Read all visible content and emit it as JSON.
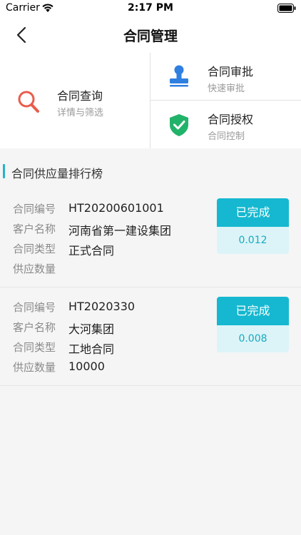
{
  "status_bar": {
    "carrier": "Carrier",
    "time": "2:17 PM"
  },
  "nav": {
    "title": "合同管理"
  },
  "functions": [
    {
      "title": "合同查询",
      "subtitle": "详情与筛选",
      "icon": "search-icon",
      "color": "#e85d4a"
    },
    {
      "title": "合同审批",
      "subtitle": "快速审批",
      "icon": "stamp-icon",
      "color": "#2f7fe0"
    },
    {
      "title": "合同授权",
      "subtitle": "合同控制",
      "icon": "shield-icon",
      "color": "#22b36a"
    }
  ],
  "ranking": {
    "title": "合同供应量排行榜",
    "labels": {
      "contract_no": "合同编号",
      "customer": "客户名称",
      "type": "合同类型",
      "quantity": "供应数量"
    },
    "items": [
      {
        "contract_no": "HT20200601001",
        "customer": "河南省第一建设集团",
        "type": "正式合同",
        "quantity": "",
        "status": "已完成",
        "amount": "0.012"
      },
      {
        "contract_no": "HT2020330",
        "customer": "大河集团",
        "type": "工地合同",
        "quantity": "10000",
        "status": "已完成",
        "amount": "0.008"
      }
    ]
  },
  "colors": {
    "accent": "#15b8d0",
    "background": "#f5f5f5"
  }
}
